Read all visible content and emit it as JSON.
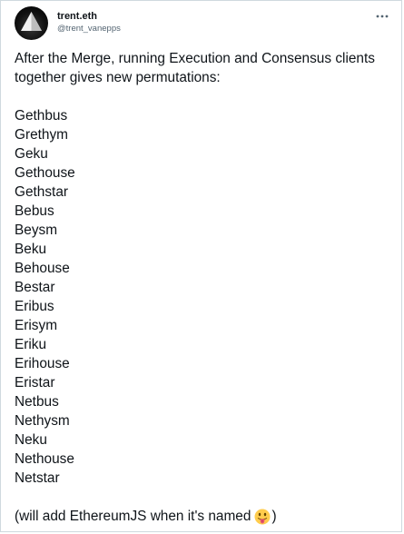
{
  "author": {
    "display_name": "trent.eth",
    "handle": "@trent_vanepps",
    "avatar_icon": "dark-pyramid-avatar"
  },
  "actions": {
    "more_icon": "more-horizontal-icon"
  },
  "tweet": {
    "intro": "After the Merge, running Execution and Consensus clients together gives new permutations:",
    "permutations": [
      "Gethbus",
      "Grethym",
      "Geku",
      "Gethouse",
      "Gethstar",
      "Bebus",
      "Beysm",
      "Beku",
      "Behouse",
      "Bestar",
      "Eribus",
      "Erisym",
      "Eriku",
      "Erihouse",
      "Eristar",
      "Netbus",
      "Nethysm",
      "Neku",
      "Nethouse",
      "Netstar"
    ],
    "outro_text": "(will add EthereumJS when it's named",
    "outro_emoji": "face-with-tongue-emoji",
    "outro_close": ")"
  },
  "colors": {
    "text": "#0f1419",
    "secondary_text": "#536471",
    "border": "#cfd9de",
    "emoji_face": "#ffcc4d",
    "emoji_tongue": "#e75a70"
  }
}
